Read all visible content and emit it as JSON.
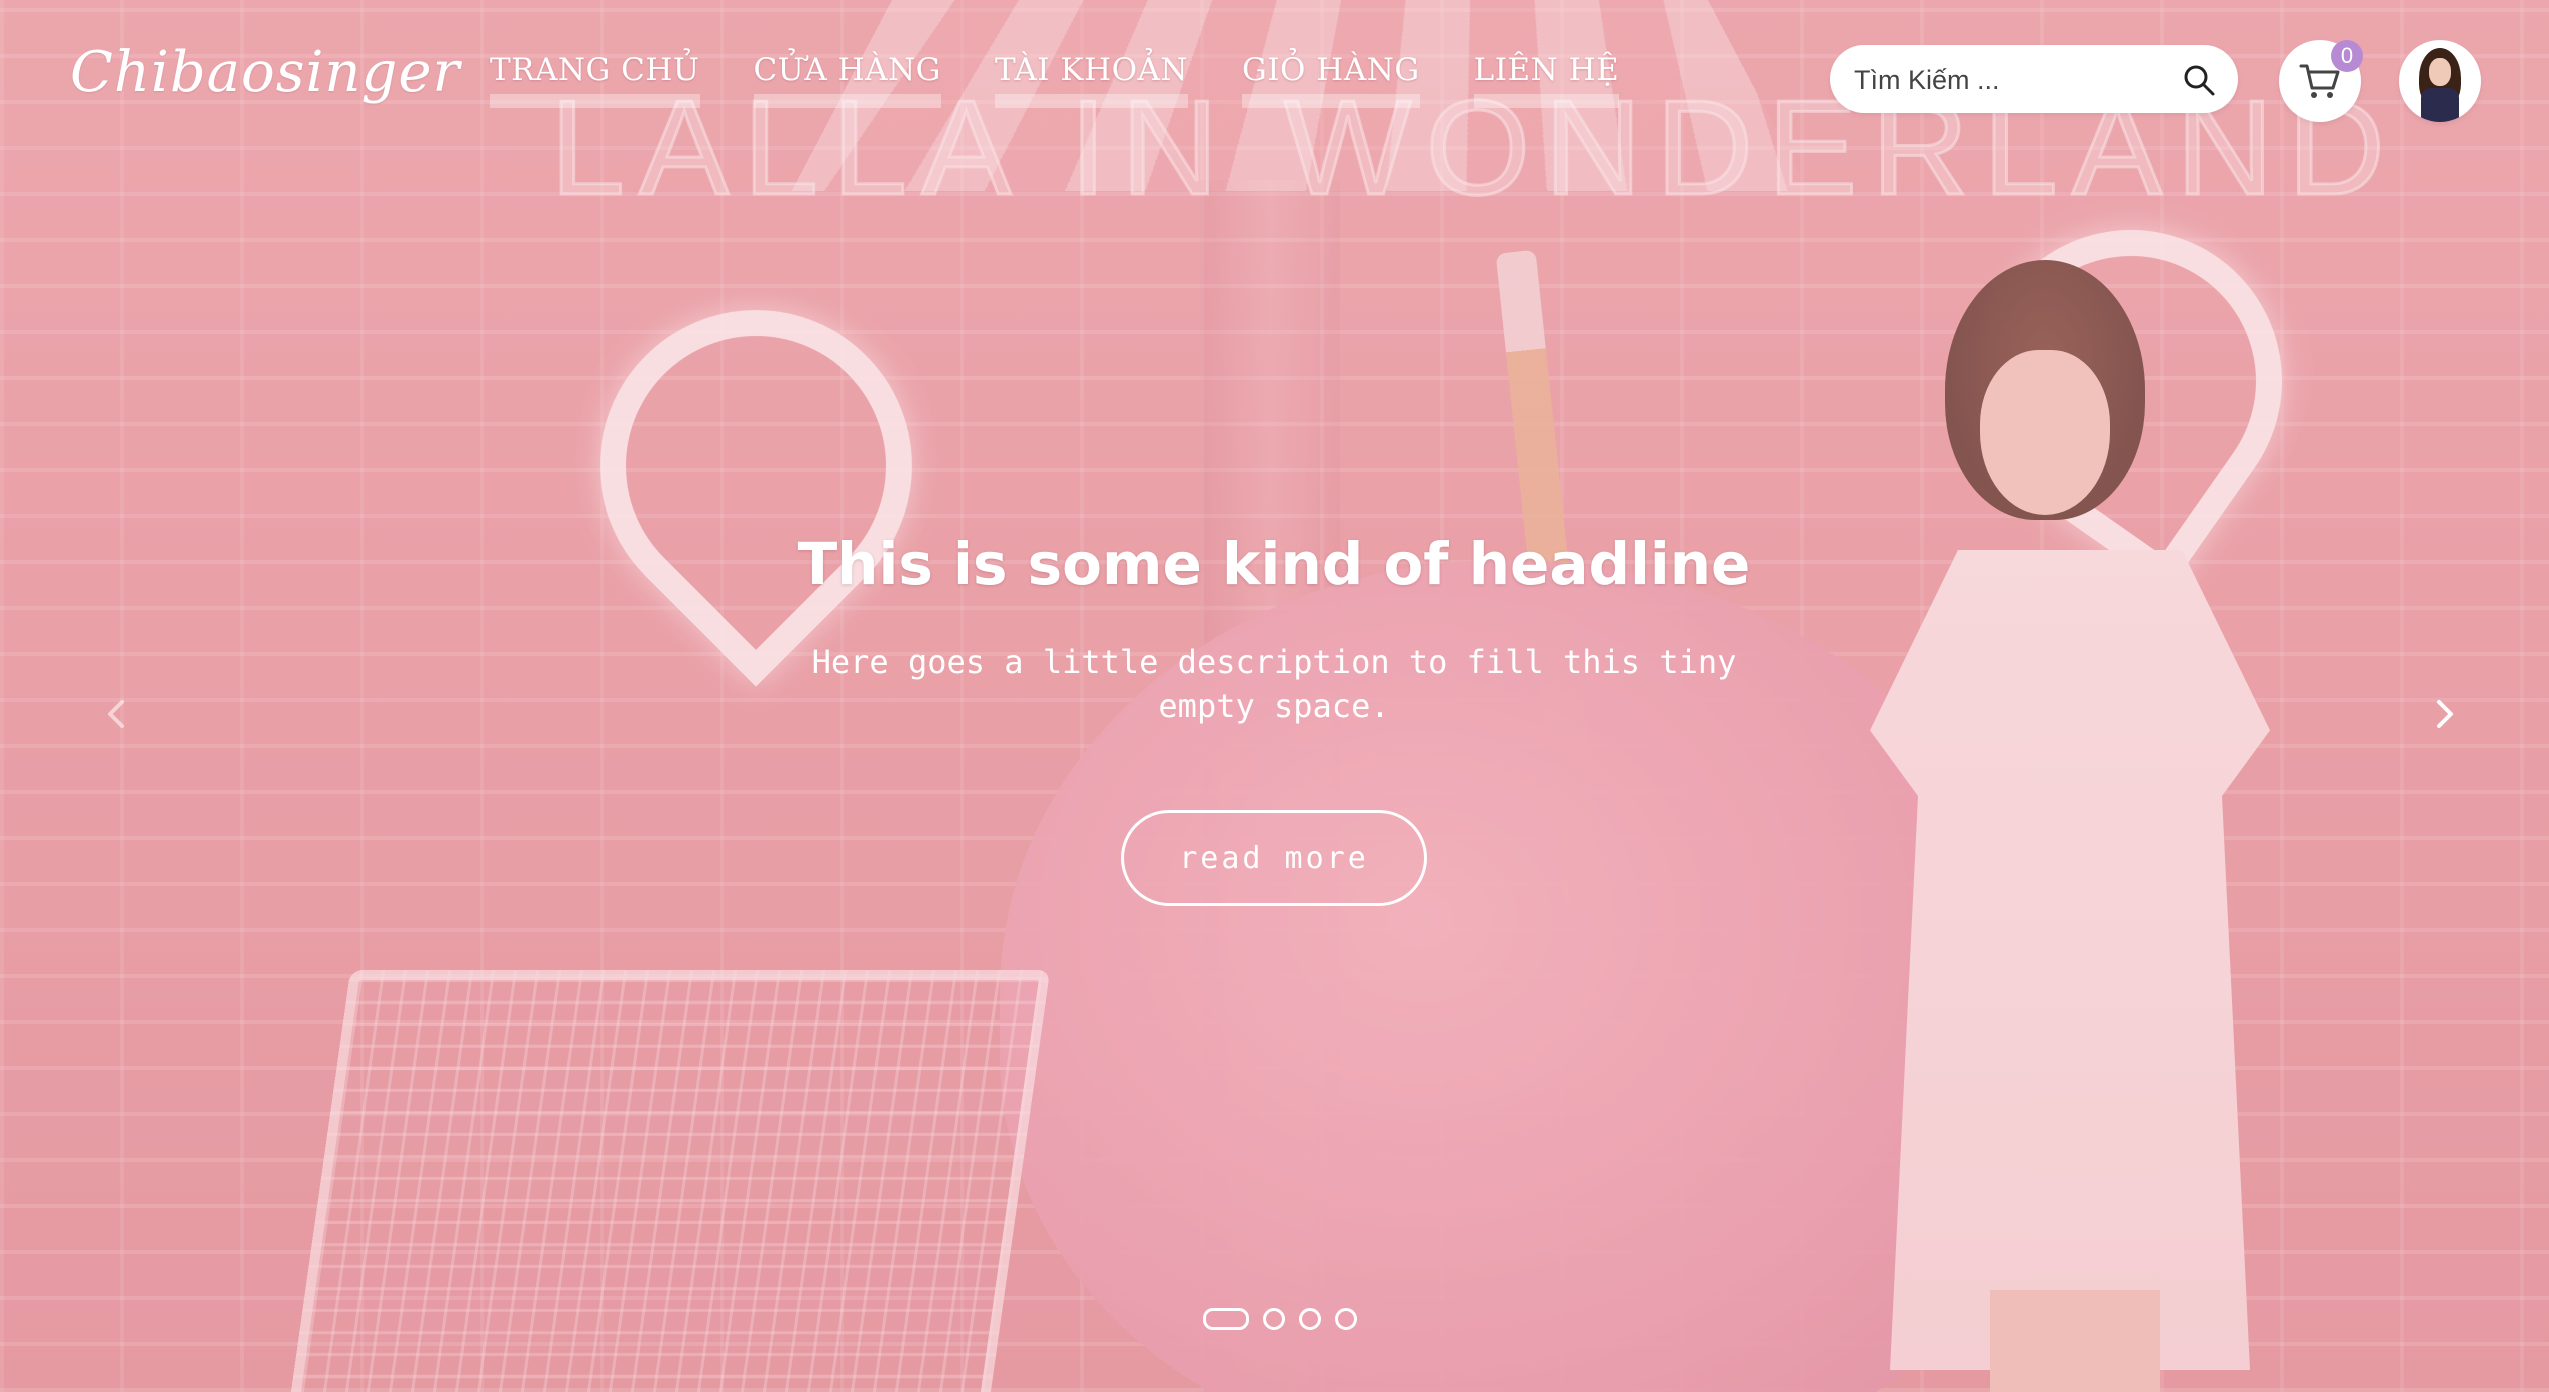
{
  "brand": {
    "logo_text": "Chibaosinger"
  },
  "nav": {
    "items": [
      {
        "label": "TRANG CHỦ"
      },
      {
        "label": "CỬA HÀNG"
      },
      {
        "label": "TÀI KHOẢN"
      },
      {
        "label": "GIỎ HÀNG"
      },
      {
        "label": "LIÊN HỆ"
      }
    ]
  },
  "search": {
    "placeholder": "Tìm Kiếm ...",
    "value": ""
  },
  "cart": {
    "count": "0",
    "icon": "cart-icon"
  },
  "user": {
    "icon": "avatar"
  },
  "hero": {
    "background_sign": "LALLA IN WONDERLAND",
    "headline": "This is some kind of headline",
    "description": "Here goes a little description to fill this tiny empty space.",
    "cta_label": "read more"
  },
  "carousel": {
    "slide_count": 4,
    "active_index": 0,
    "prev_icon": "chevron-left-icon",
    "next_icon": "chevron-right-icon"
  },
  "colors": {
    "background": "#e9a3a8",
    "text": "#ffffff",
    "badge": "#b78ad4"
  }
}
